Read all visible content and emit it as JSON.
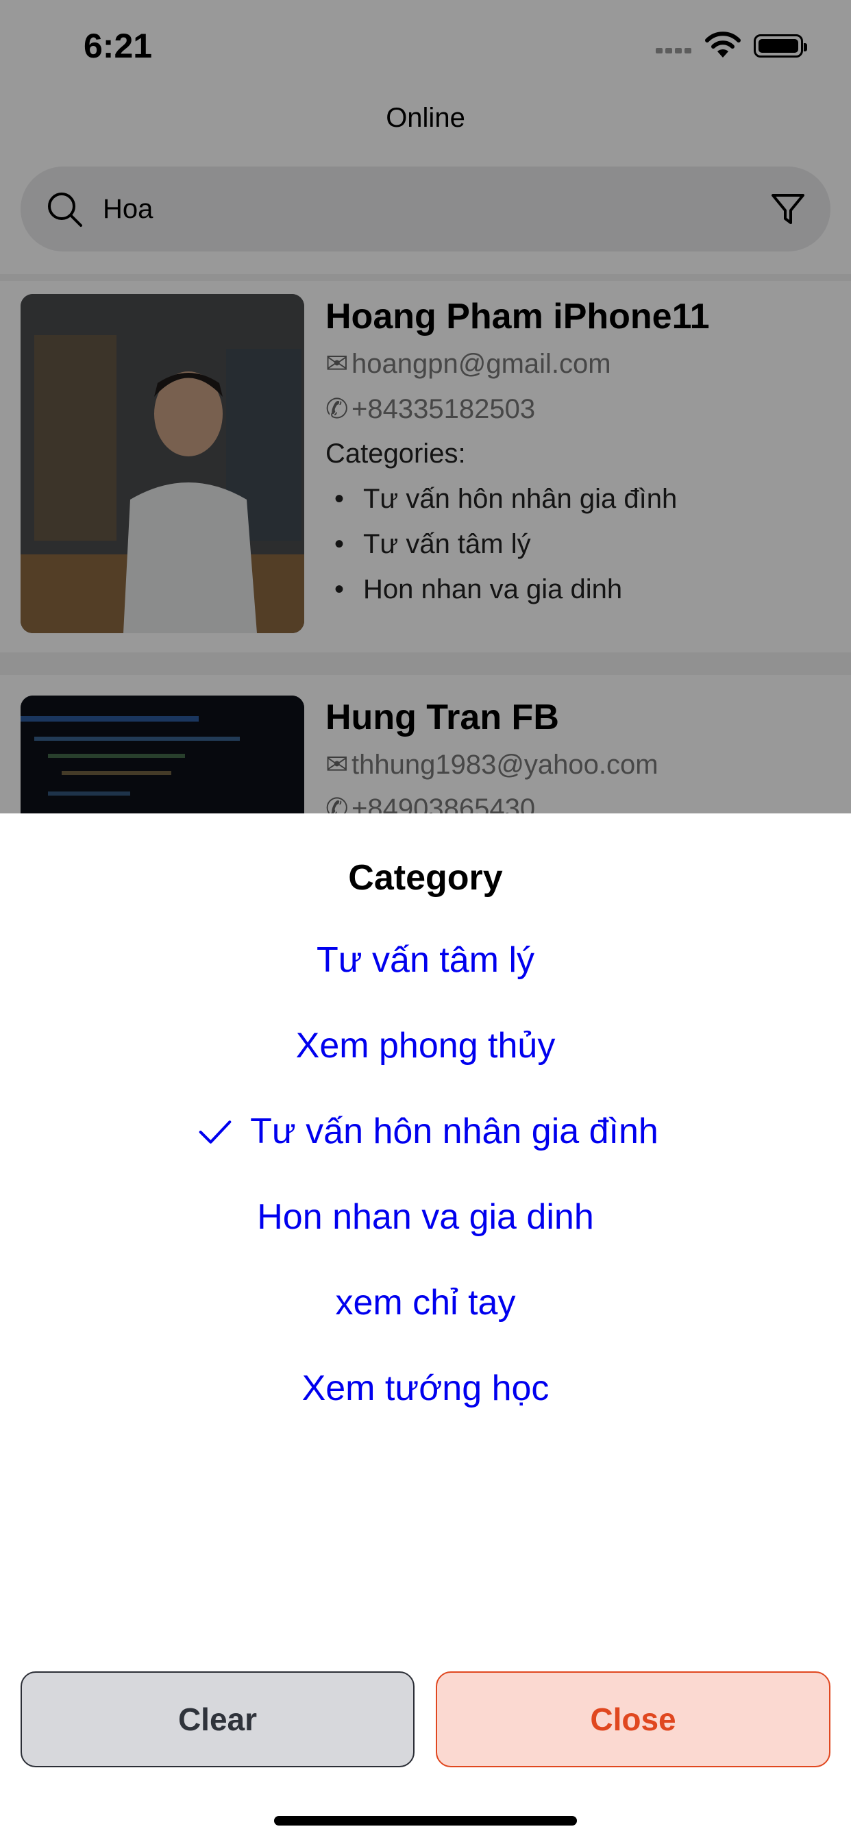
{
  "status_bar": {
    "time": "6:21"
  },
  "nav": {
    "title": "Online"
  },
  "search": {
    "value": "Hoa",
    "placeholder": ""
  },
  "list": [
    {
      "name": "Hoang Pham iPhone11",
      "email": "hoangpn@gmail.com",
      "phone": "+84335182503",
      "categories_label": "Categories:",
      "categories": [
        "Tư vấn hôn nhân gia đình",
        "Tư vấn tâm lý",
        "Hon nhan va gia dinh"
      ]
    },
    {
      "name": "Hung Tran FB",
      "email": "thhung1983@yahoo.com",
      "phone": "+84903865430"
    }
  ],
  "sheet": {
    "title": "Category",
    "options": [
      {
        "label": "Tư vấn tâm lý",
        "selected": false
      },
      {
        "label": "Xem phong thủy",
        "selected": false
      },
      {
        "label": "Tư vấn hôn nhân gia đình",
        "selected": true
      },
      {
        "label": "Hon nhan va gia dinh",
        "selected": false
      },
      {
        "label": "xem chỉ tay",
        "selected": false
      },
      {
        "label": "Xem tướng học",
        "selected": false
      }
    ],
    "clear_label": "Clear",
    "close_label": "Close"
  },
  "colors": {
    "accent": "#0000ee",
    "close_text": "#e0471f",
    "close_bg": "#fbd9d1",
    "clear_bg": "#d7d8dc"
  },
  "icons": {
    "search": "search-icon",
    "filter": "filter-icon",
    "email": "envelope-icon",
    "phone": "phone-icon",
    "check": "checkmark-icon"
  }
}
